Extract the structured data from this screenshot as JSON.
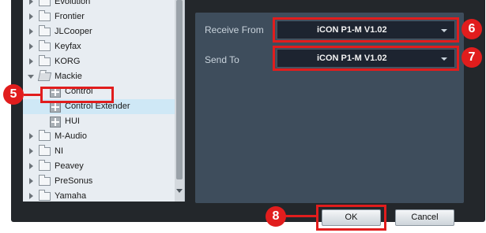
{
  "tree": {
    "items": [
      {
        "label": "Evolution",
        "kind": "folder"
      },
      {
        "label": "Frontier",
        "kind": "folder"
      },
      {
        "label": "JLCooper",
        "kind": "folder"
      },
      {
        "label": "Keyfax",
        "kind": "folder"
      },
      {
        "label": "KORG",
        "kind": "folder"
      },
      {
        "label": "Mackie",
        "kind": "folder-open"
      },
      {
        "label": "Control",
        "kind": "device"
      },
      {
        "label": "Control Extender",
        "kind": "device",
        "selected": true
      },
      {
        "label": "HUI",
        "kind": "device"
      },
      {
        "label": "M-Audio",
        "kind": "folder"
      },
      {
        "label": "NI",
        "kind": "folder"
      },
      {
        "label": "Peavey",
        "kind": "folder"
      },
      {
        "label": "PreSonus",
        "kind": "folder"
      },
      {
        "label": "Yamaha",
        "kind": "folder"
      }
    ]
  },
  "settings": {
    "receive_from_label": "Receive From",
    "receive_from_value": "iCON P1-M V1.02",
    "send_to_label": "Send To",
    "send_to_value": "iCON P1-M V1.02"
  },
  "buttons": {
    "ok": "OK",
    "cancel": "Cancel"
  },
  "callouts": {
    "tree_item": "5",
    "receive_from": "6",
    "send_to": "7",
    "ok": "8"
  },
  "colors": {
    "callout": "#e11d1d",
    "panel": "#3e4d5c",
    "dialog": "#23272b",
    "selection": "#cfe8f6"
  }
}
